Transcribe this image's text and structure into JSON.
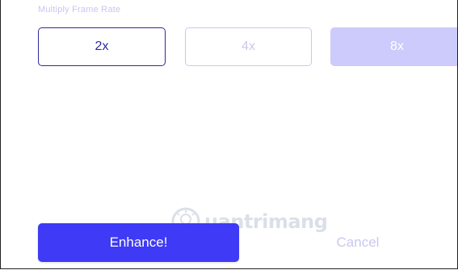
{
  "frame_rate": {
    "label": "Multiply Frame Rate",
    "options": [
      {
        "label": "2x",
        "state": "selected"
      },
      {
        "label": "4x",
        "state": "available"
      },
      {
        "label": "8x",
        "state": "disabled"
      }
    ]
  },
  "actions": {
    "enhance_label": "Enhance!",
    "cancel_label": "Cancel"
  },
  "watermark": {
    "text": "uantrimang",
    "icon": "lightbulb-logo-icon"
  },
  "colors": {
    "primary": "#3e3af5",
    "selected_border": "#2e2a9c",
    "muted": "#c9c7f2",
    "disabled_fill": "#cccbfb"
  }
}
